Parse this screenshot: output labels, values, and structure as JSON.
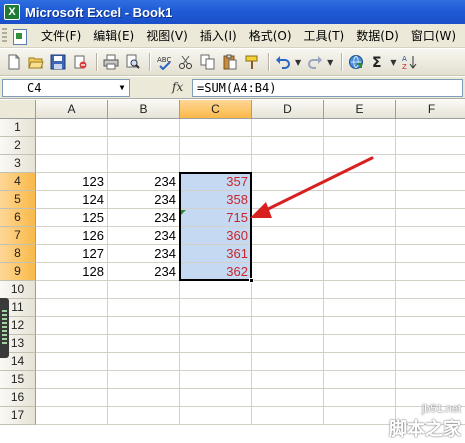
{
  "window": {
    "title": "Microsoft Excel - Book1",
    "app_icon": "excel-icon"
  },
  "menu": {
    "items": [
      {
        "label": "文件(F)"
      },
      {
        "label": "编辑(E)"
      },
      {
        "label": "视图(V)"
      },
      {
        "label": "插入(I)"
      },
      {
        "label": "格式(O)"
      },
      {
        "label": "工具(T)"
      },
      {
        "label": "数据(D)"
      },
      {
        "label": "窗口(W)"
      }
    ]
  },
  "toolbar": {
    "buttons": [
      "new-icon",
      "open-icon",
      "save-icon",
      "permission-icon",
      "print-icon",
      "print-preview-icon",
      "spelling-icon",
      "cut-icon",
      "copy-icon",
      "paste-icon",
      "format-painter-icon",
      "undo-icon",
      "redo-icon",
      "hyperlink-icon",
      "autosum-icon",
      "sort-icon"
    ]
  },
  "formula_bar": {
    "name_box": "C4",
    "fx_label": "fx",
    "formula": "=SUM(A4:B4)"
  },
  "sheet": {
    "columns": [
      "A",
      "B",
      "C",
      "D",
      "E",
      "F"
    ],
    "selected_column": "C",
    "rows": [
      "1",
      "2",
      "3",
      "4",
      "5",
      "6",
      "7",
      "8",
      "9",
      "10",
      "11",
      "12",
      "13",
      "14",
      "15",
      "16",
      "17"
    ],
    "selected_rows": [
      "4",
      "5",
      "6",
      "7",
      "8",
      "9"
    ],
    "cells": {
      "A4": "123",
      "B4": "234",
      "C4": "357",
      "A5": "124",
      "B5": "234",
      "C5": "358",
      "A6": "125",
      "B6": "234",
      "C6": "715",
      "A7": "126",
      "B7": "234",
      "C7": "360",
      "A8": "127",
      "B8": "234",
      "C8": "361",
      "A9": "128",
      "B9": "234",
      "C9": "362"
    }
  },
  "colors": {
    "selection": "#c5daf2",
    "sum_text": "#c8262b",
    "header_selected": "#f9b949",
    "arrow": "#d82020"
  },
  "watermark": {
    "line1": "jb51.net",
    "line2": "脚本之家"
  }
}
